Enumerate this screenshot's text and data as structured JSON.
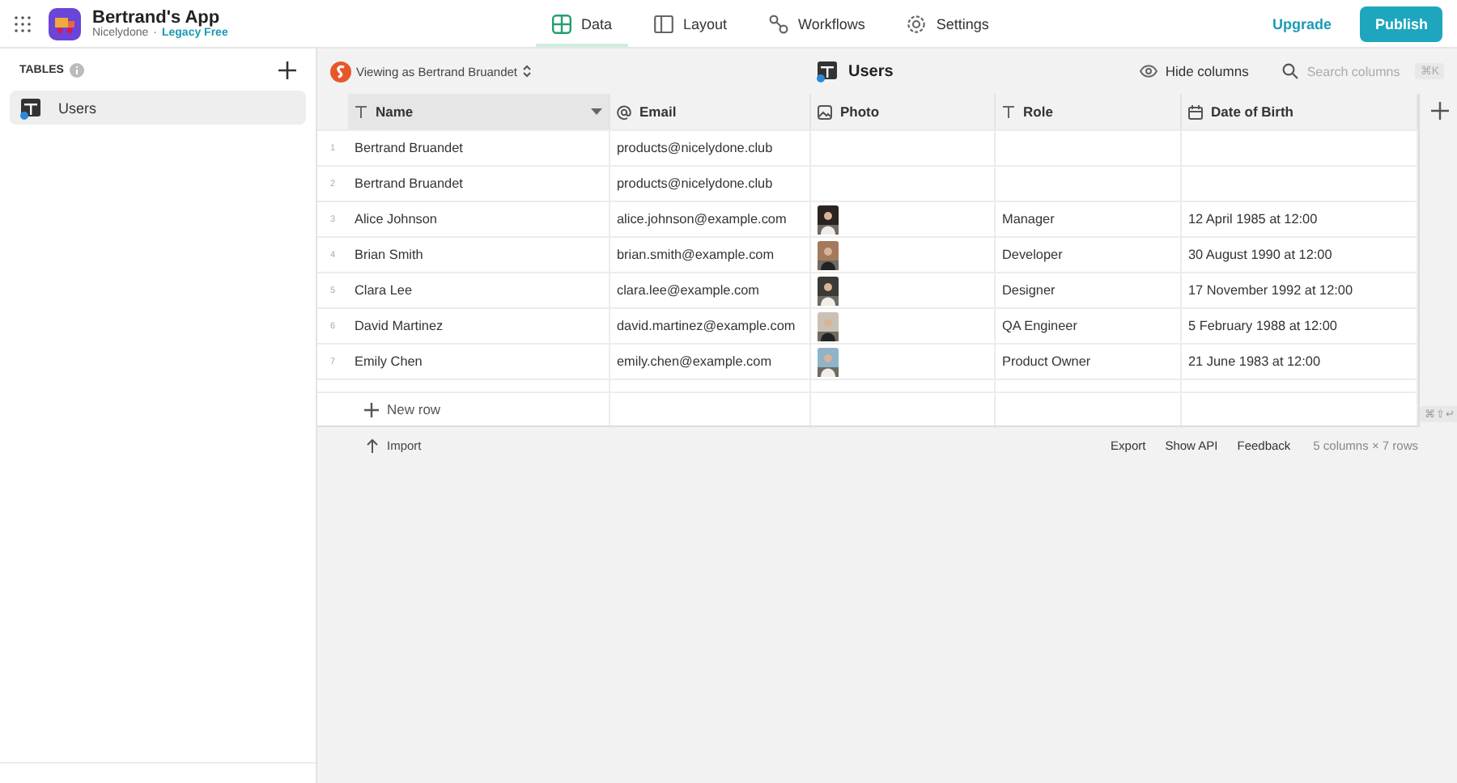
{
  "app": {
    "name": "Bertrand's App",
    "workspace": "Nicelydone",
    "separator": "·",
    "plan": "Legacy Free"
  },
  "nav_tabs": [
    {
      "label": "Data",
      "selected": true
    },
    {
      "label": "Layout",
      "selected": false
    },
    {
      "label": "Workflows",
      "selected": false
    },
    {
      "label": "Settings",
      "selected": false
    }
  ],
  "actions": {
    "upgrade": "Upgrade",
    "publish": "Publish"
  },
  "sidebar": {
    "heading": "TABLES",
    "items": [
      {
        "label": "Users",
        "selected": true
      }
    ]
  },
  "toolbar": {
    "viewing_as": "Viewing as Bertrand Bruandet",
    "table_title": "Users",
    "hide_columns": "Hide columns",
    "search": {
      "placeholder": "Search columns"
    },
    "shortcut": "⌘K"
  },
  "table": {
    "columns": [
      {
        "label": "Name",
        "kind": "text"
      },
      {
        "label": "Email",
        "kind": "email"
      },
      {
        "label": "Photo"
      },
      {
        "label": "Role",
        "kind": "text"
      },
      {
        "label": "Date of Birth",
        "kind": "date"
      }
    ],
    "rows": [
      {
        "number": "1",
        "name": "Bertrand Bruandet",
        "email": "products@nicelydone.club",
        "photo": false,
        "role": "",
        "dob": ""
      },
      {
        "number": "2",
        "name": "Bertrand Bruandet",
        "email": "products@nicelydone.club",
        "photo": false,
        "role": "",
        "dob": ""
      },
      {
        "number": "3",
        "name": "Alice Johnson",
        "email": "alice.johnson@example.com",
        "photo": true,
        "role": "Manager",
        "dob": "12 April 1985 at 12:00"
      },
      {
        "number": "4",
        "name": "Brian Smith",
        "email": "brian.smith@example.com",
        "photo": true,
        "role": "Developer",
        "dob": "30 August 1990 at 12:00"
      },
      {
        "number": "5",
        "name": "Clara Lee",
        "email": "clara.lee@example.com",
        "photo": true,
        "role": "Designer",
        "dob": "17 November 1992 at 12:00"
      },
      {
        "number": "6",
        "name": "David Martinez",
        "email": "david.martinez@example.com",
        "photo": true,
        "role": "QA Engineer",
        "dob": "5 February 1988 at 12:00"
      },
      {
        "number": "7",
        "name": "Emily Chen",
        "email": "emily.chen@example.com",
        "photo": true,
        "role": "Product Owner",
        "dob": "21 June 1983 at 12:00"
      }
    ],
    "new_row": "New row",
    "new_row_shortcut": "⌘⇧↵"
  },
  "footer": {
    "import": "Import",
    "links": [
      "Export",
      "Show API",
      "Feedback"
    ],
    "summary": "5 columns × 7 rows"
  }
}
